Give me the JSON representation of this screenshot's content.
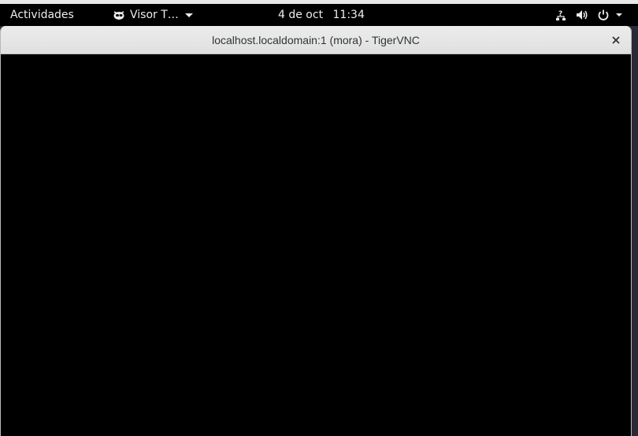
{
  "top_bar": {
    "activities_label": "Actividades",
    "app_menu": {
      "label": "Visor T…",
      "icon": "vnc-viewer-icon"
    },
    "clock": {
      "date": "4 de oct",
      "time": "11:34"
    },
    "status_icons": [
      "network-question-icon",
      "volume-icon",
      "power-icon",
      "chevron-down-icon"
    ]
  },
  "window": {
    "title": "localhost.localdomain:1 (mora) - TigerVNC",
    "close_icon": "close-icon"
  },
  "colors": {
    "top_bar_bg": "#000000",
    "titlebar_bg": "#e8e8e8",
    "vnc_bg": "#000000",
    "desktop_bg": "#2b2938"
  }
}
